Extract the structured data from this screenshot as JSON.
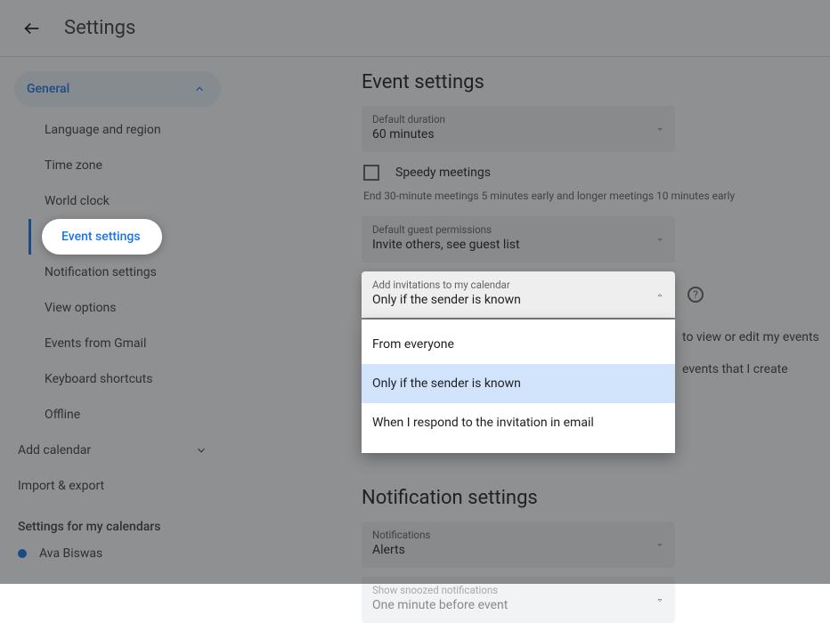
{
  "topbar": {
    "title": "Settings"
  },
  "sidebar": {
    "general_label": "General",
    "items": [
      "Language and region",
      "Time zone",
      "World clock",
      "Event settings",
      "Notification settings",
      "View options",
      "Events from Gmail",
      "Keyboard shortcuts",
      "Offline"
    ],
    "add_calendar": "Add calendar",
    "import_export": "Import & export",
    "my_calendars_header": "Settings for my calendars",
    "user_name": "Ava Biswas"
  },
  "main": {
    "event_settings_title": "Event settings",
    "default_duration": {
      "label": "Default duration",
      "value": "60 minutes"
    },
    "speedy_meetings_label": "Speedy meetings",
    "speedy_helper": "End 30-minute meetings 5 minutes early and longer meetings 10 minutes early",
    "guest_permissions": {
      "label": "Default guest permissions",
      "value": "Invite others, see guest list"
    },
    "invitations": {
      "label": "Add invitations to my calendar",
      "value": "Only if the sender is known",
      "options": [
        "From everyone",
        "Only if the sender is known",
        "When I respond to the invitation in email"
      ]
    },
    "occluded_line1_suffix": "to view or edit my events",
    "occluded_line2_suffix": "events that I create",
    "notification_title": "Notification settings",
    "notifications": {
      "label": "Notifications",
      "value": "Alerts"
    },
    "snoozed": {
      "label": "Show snoozed notifications",
      "value": "One minute before event"
    }
  }
}
